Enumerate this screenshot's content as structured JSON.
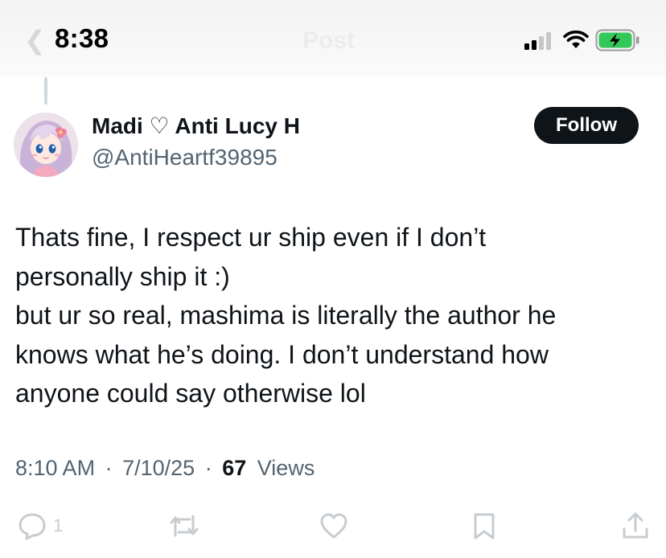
{
  "status_bar": {
    "time": "8:38",
    "signal_icon": "cellular-signal-icon",
    "wifi_icon": "wifi-icon",
    "battery_icon": "battery-charging-icon",
    "battery_color": "#34c759"
  },
  "header": {
    "title": "Post",
    "back_icon": "back-arrow-icon"
  },
  "author": {
    "display_name": "Madi ♡ Anti Lucy H",
    "handle": "@AntiHeartf39895"
  },
  "follow_button": {
    "label": "Follow"
  },
  "tweet": {
    "lines": [
      "Thats fine, I respect ur ship even if I don’t",
      "personally ship it :)",
      "but ur so real, mashima is literally the author he",
      "knows what he’s doing. I don’t understand how",
      "anyone could say otherwise lol"
    ]
  },
  "meta": {
    "time": "8:10 AM",
    "date": "7/10/25",
    "views_count": "67",
    "views_label": "Views",
    "separator": "·"
  },
  "actions": {
    "reply": {
      "icon": "reply-icon",
      "count": "1"
    },
    "repost": {
      "icon": "repost-icon"
    },
    "like": {
      "icon": "heart-icon"
    },
    "bookmark": {
      "icon": "bookmark-icon"
    },
    "share": {
      "icon": "share-icon"
    }
  },
  "colors": {
    "text_primary": "#0f1419",
    "text_secondary": "#536471",
    "follow_bg": "#0f1419",
    "thread_line": "#cfd9de"
  }
}
